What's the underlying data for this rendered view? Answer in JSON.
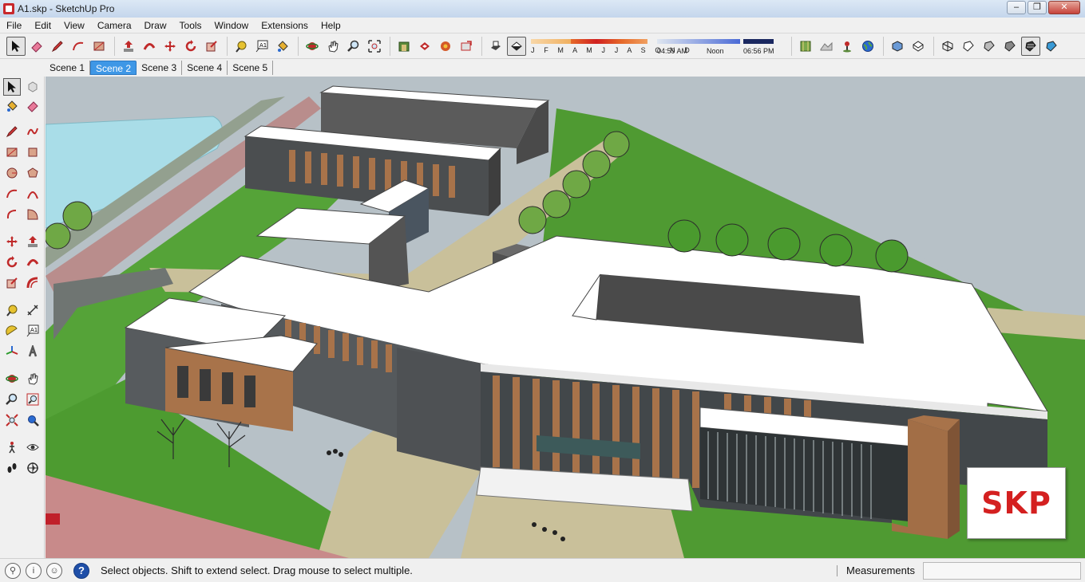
{
  "window": {
    "title": "A1.skp - SketchUp Pro",
    "minimize": "–",
    "restore": "❐",
    "close": "✕"
  },
  "menu": [
    "File",
    "Edit",
    "View",
    "Camera",
    "Draw",
    "Tools",
    "Window",
    "Extensions",
    "Help"
  ],
  "shadows": {
    "months_label": "J F M A M J J A S O N D",
    "time_start": "04:59 AM",
    "time_mid": "Noon",
    "time_end": "06:56 PM"
  },
  "scenes": [
    {
      "label": "Scene 1",
      "active": false
    },
    {
      "label": "Scene 2",
      "active": true
    },
    {
      "label": "Scene 3",
      "active": false
    },
    {
      "label": "Scene 4",
      "active": false
    },
    {
      "label": "Scene 5",
      "active": false
    }
  ],
  "watermark": "SKP",
  "status": {
    "message": "Select objects. Shift to extend select. Drag mouse to select multiple.",
    "measurements_label": "Measurements",
    "measurements_value": ""
  },
  "colors": {
    "accent": "#3e97e6",
    "grass": "#5aa83a",
    "facade_wood": "#a8734a",
    "roof": "#ffffff",
    "logo": "#d42020"
  }
}
